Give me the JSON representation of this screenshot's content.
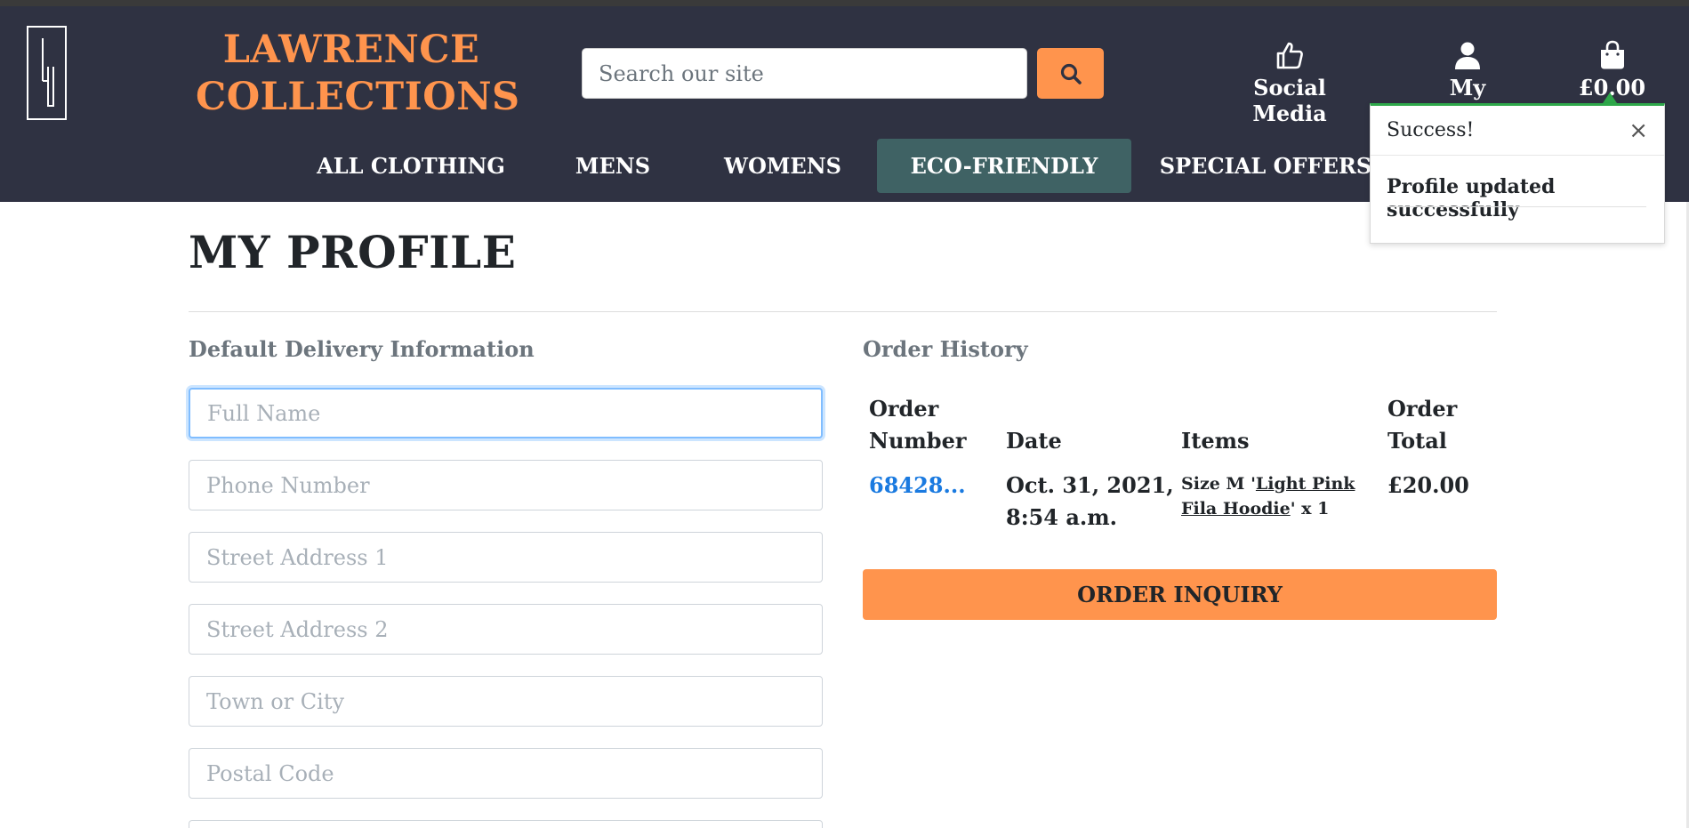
{
  "brand": {
    "line1": "LAWRENCE",
    "line2": "COLLECTIONS",
    "accent": "#ff944d"
  },
  "search": {
    "placeholder": "Search our site",
    "button_icon": "search-icon"
  },
  "header_links": {
    "social": {
      "label": "Social Media",
      "icon": "thumbs-up-icon"
    },
    "account": {
      "label": "My Account",
      "icon": "user-icon"
    },
    "bag": {
      "label": "£0.00",
      "icon": "shopping-bag-icon"
    }
  },
  "nav": {
    "items": [
      {
        "label": "ALL CLOTHING"
      },
      {
        "label": "MENS"
      },
      {
        "label": "WOMENS"
      },
      {
        "label": "ECO-FRIENDLY",
        "active": true
      },
      {
        "label": "SPECIAL OFFERS"
      }
    ]
  },
  "toast": {
    "title": "Success!",
    "close": "×",
    "message": "Profile updated successfully",
    "color": "#2ea84a"
  },
  "page": {
    "title": "MY PROFILE"
  },
  "delivery": {
    "heading": "Default Delivery Information",
    "fields": [
      {
        "placeholder": "Full Name",
        "value": ""
      },
      {
        "placeholder": "Phone Number",
        "value": ""
      },
      {
        "placeholder": "Street Address 1",
        "value": ""
      },
      {
        "placeholder": "Street Address 2",
        "value": ""
      },
      {
        "placeholder": "Town or City",
        "value": ""
      },
      {
        "placeholder": "Postal Code",
        "value": ""
      }
    ]
  },
  "orders": {
    "heading": "Order History",
    "columns": {
      "number_1": "Order",
      "number_2": "Number",
      "date": "Date",
      "items": "Items",
      "total_1": "Order",
      "total_2": "Total"
    },
    "rows": [
      {
        "number": "68428...",
        "date_1": "Oct. 31, 2021,",
        "date_2": "8:54 a.m.",
        "items_prefix": "Size M '",
        "items_link": "Light Pink Fila Hoodie",
        "items_suffix": "' x 1",
        "total": "£20.00"
      }
    ],
    "inquiry_button": "ORDER INQUIRY"
  }
}
